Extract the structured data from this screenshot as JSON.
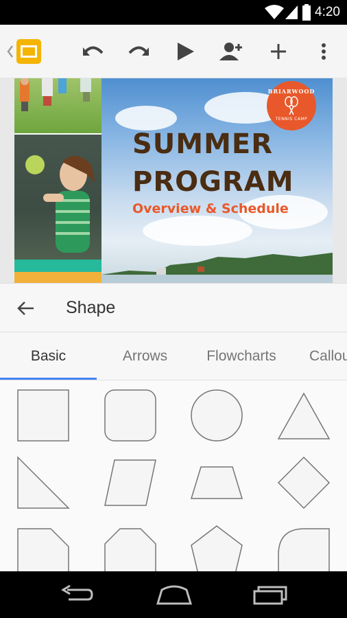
{
  "status_bar": {
    "time": "4:20"
  },
  "slide": {
    "title_line1": "SUMMER",
    "title_line2": "PROGRAM",
    "subtitle": "Overview & Schedule",
    "badge_top": "BRIARWOOD",
    "badge_bottom": "TENNIS CAMP"
  },
  "shape_panel": {
    "title": "Shape",
    "tabs": [
      {
        "label": "Basic",
        "active": true
      },
      {
        "label": "Arrows",
        "active": false
      },
      {
        "label": "Flowcharts",
        "active": false
      },
      {
        "label": "Callou",
        "active": false
      }
    ],
    "shapes": [
      "rectangle",
      "rounded-rectangle",
      "ellipse",
      "triangle",
      "right-triangle",
      "parallelogram",
      "trapezoid",
      "diamond",
      "snip-corner-rectangle",
      "octagon",
      "pentagon",
      "round-corner-shape"
    ]
  },
  "colors": {
    "accent": "#4285f4",
    "app_icon": "#f4b400",
    "title_brown": "#4a2d12",
    "subtitle_orange": "#e8582a"
  }
}
